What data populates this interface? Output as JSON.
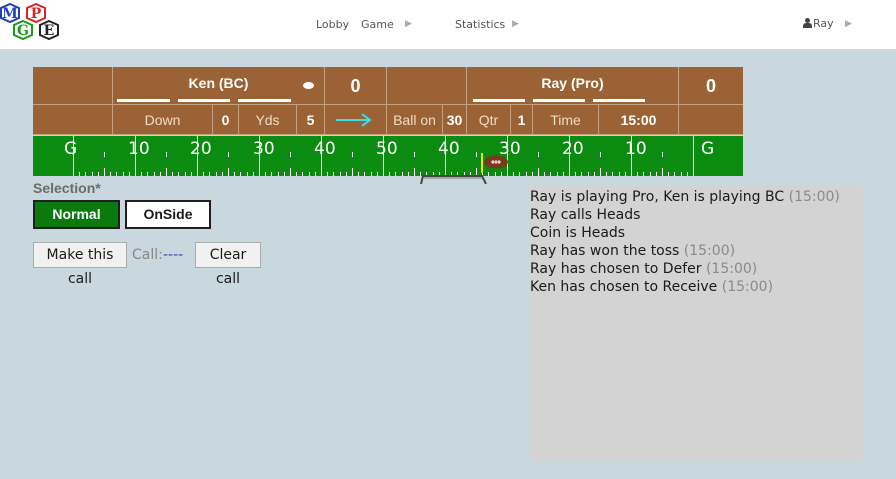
{
  "header": {
    "logo_letters": [
      "M",
      "P",
      "G",
      "E"
    ],
    "nav": {
      "lobby": "Lobby",
      "game": "Game",
      "statistics": "Statistics",
      "user": "Ray"
    },
    "caret": "▶"
  },
  "scoreboard": {
    "away": {
      "name": "Ken (BC)",
      "score": "0",
      "timeouts": 3
    },
    "home": {
      "name": "Ray (Pro)",
      "score": "0",
      "timeouts": 3
    },
    "down_label": "Down",
    "down": "0",
    "yds_label": "Yds",
    "yds": "5",
    "ball_on_label": "Ball on",
    "ball_on": "30",
    "qtr_label": "Qtr",
    "qtr": "1",
    "time_label": "Time",
    "time": "15:00",
    "direction_icon": "arrow-right-icon",
    "possession_icon": "football-dot-icon"
  },
  "field": {
    "yard_labels": [
      "G",
      "10",
      "20",
      "30",
      "40",
      "50",
      "40",
      "30",
      "20",
      "10",
      "G"
    ],
    "ball_icon": "football-icon",
    "colors": {
      "grass": "#0b8b10",
      "board": "#9a6235",
      "marker": "#e8e600",
      "arrow": "#3ee0e6"
    }
  },
  "selection": {
    "label": "Selection*",
    "options": [
      {
        "label": "Normal",
        "selected": true
      },
      {
        "label": "OnSide",
        "selected": false
      }
    ],
    "make_call": "Make this call",
    "call_label": "Call:",
    "call_value": "----",
    "clear_call": "Clear call"
  },
  "log": [
    {
      "text": "Ray is playing Pro, Ken is playing BC",
      "time": "(15:00)"
    },
    {
      "text": "Ray calls Heads",
      "time": ""
    },
    {
      "text": "Coin is Heads",
      "time": ""
    },
    {
      "text": "Ray has won the toss",
      "time": "(15:00)"
    },
    {
      "text": "Ray has chosen to Defer",
      "time": "(15:00)"
    },
    {
      "text": "Ken has chosen to Receive",
      "time": "(15:00)"
    }
  ]
}
